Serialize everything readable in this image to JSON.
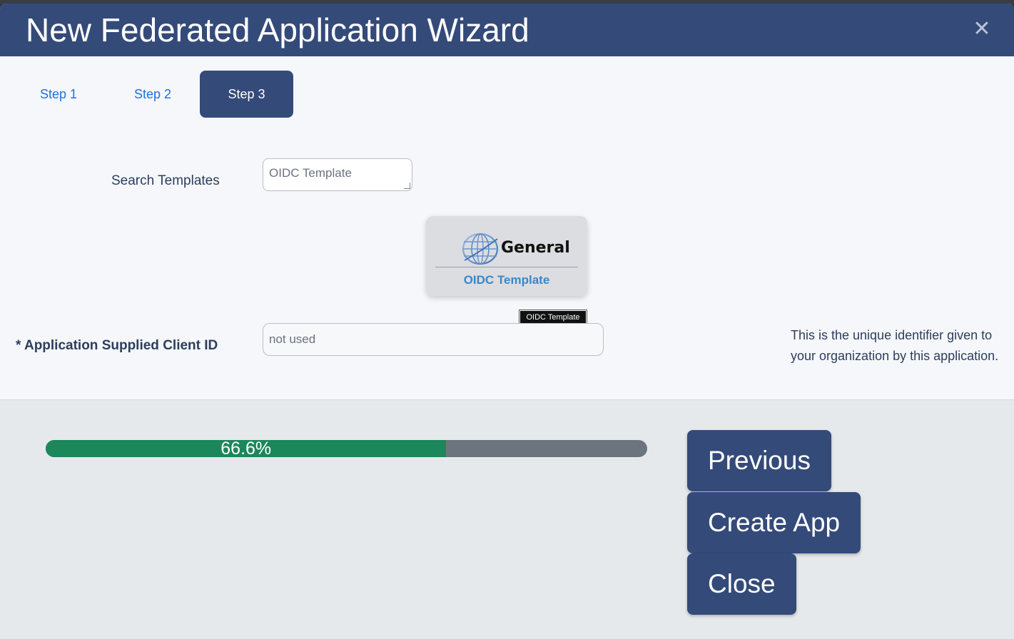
{
  "modal": {
    "title": "New Federated Application Wizard",
    "close_icon": "close-icon"
  },
  "steps": [
    {
      "label": "Step 1",
      "active": false
    },
    {
      "label": "Step 2",
      "active": false
    },
    {
      "label": "Step 3",
      "active": true
    }
  ],
  "search": {
    "label": "Search Templates",
    "value": "OIDC Template"
  },
  "template_card": {
    "brand": "General",
    "name": "OIDC Template",
    "logo_icon": "globe-icon",
    "tooltip": "OIDC Template"
  },
  "client_id": {
    "label": "* Application Supplied Client ID",
    "placeholder": "not used",
    "help": "This is the unique identifier given to your organization by this application."
  },
  "progress": {
    "percent": 66.6,
    "label": "66.6%"
  },
  "buttons": {
    "previous": "Previous",
    "create": "Create App",
    "close": "Close"
  },
  "colors": {
    "header": "#344a79",
    "progress_fill": "#1b875a",
    "progress_track": "#6c757d",
    "link": "#1f6fe0"
  }
}
